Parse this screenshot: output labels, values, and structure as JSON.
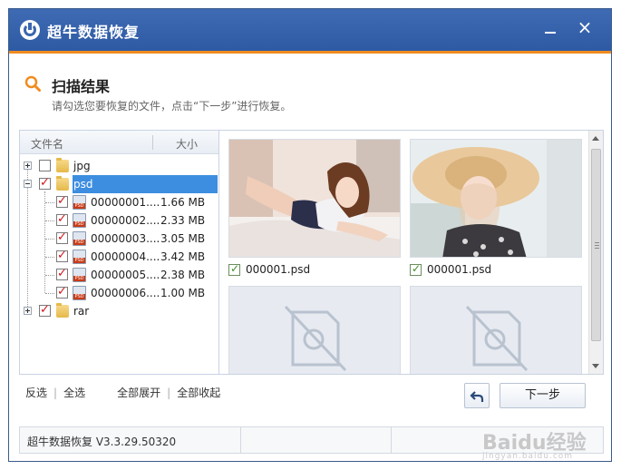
{
  "window": {
    "title": "超牛数据恢复"
  },
  "header": {
    "title": "扫描结果",
    "subtitle": "请勾选您要恢复的文件，点击“下一步”进行恢复。"
  },
  "tree": {
    "columns": {
      "name": "文件名",
      "size": "大小"
    },
    "folders": [
      {
        "label": "jpg",
        "checked": false,
        "expanded": false
      },
      {
        "label": "psd",
        "checked": true,
        "expanded": true,
        "selected": true
      },
      {
        "label": "rar",
        "checked": true,
        "expanded": false
      }
    ],
    "files": [
      {
        "name": "00000001....",
        "size": "1.66 MB"
      },
      {
        "name": "00000002....",
        "size": "2.33 MB"
      },
      {
        "name": "00000003....",
        "size": "3.05 MB"
      },
      {
        "name": "00000004....",
        "size": "3.42 MB"
      },
      {
        "name": "00000005....",
        "size": "2.38 MB"
      },
      {
        "name": "00000006....",
        "size": "1.00 MB"
      }
    ]
  },
  "preview": {
    "items": [
      {
        "caption": "000001.psd",
        "checked": true
      },
      {
        "caption": "000001.psd",
        "checked": true
      }
    ]
  },
  "actions": {
    "invert": "反选",
    "select_all": "全选",
    "expand_all": "全部展开",
    "collapse_all": "全部收起",
    "next": "下一步"
  },
  "status": {
    "version": "超牛数据恢复 V3.3.29.50320"
  },
  "watermark": {
    "brand": "Baidu经验",
    "url": "jingyan.baidu.com"
  },
  "colors": {
    "titlebar": "#3f6bb5",
    "accent_line": "#f08c1e",
    "selection": "#3d8ee0",
    "check": "#d0151b"
  }
}
